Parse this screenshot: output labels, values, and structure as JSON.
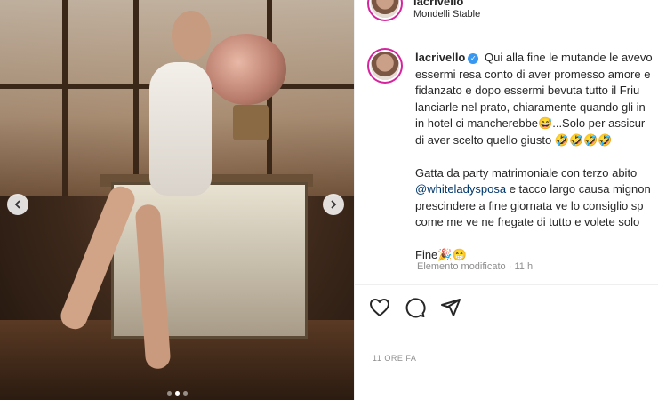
{
  "post": {
    "header": {
      "username": "lacrivello",
      "location": "Mondelli Stable"
    },
    "caption": {
      "username": "lacrivello",
      "paragraph1": "Qui alla fine le mutande le avevo\nessermi resa conto di aver promesso amore e\nfidanzato e dopo essermi bevuta tutto il Friu\nlanciarle nel prato, chiaramente quando gli in\nin hotel ci mancherebbe😅...Solo per assicur\ndi aver scelto quello giusto 🤣🤣🤣🤣",
      "paragraph2_start": "Gatta da party matrimoniale con terzo abito",
      "mention": "@whiteladysposa",
      "paragraph2_rest": " e tacco largo causa mignon\nprescindere a fine giornata ve lo consiglio sp\ncome me ve ne fregate di tutto e volete solo",
      "paragraph3": "Fine🎉😁"
    },
    "meta": {
      "edited": "Elemento modificato",
      "separator": "·",
      "age": "11 h"
    },
    "timestamp": "11 ORE FA",
    "carousel": {
      "total_dots": 3,
      "active_index": 1
    }
  },
  "icons": {
    "prev": "chevron-left-icon",
    "next": "chevron-right-icon",
    "like": "heart-icon",
    "comment": "comment-icon",
    "share": "share-icon",
    "verified": "verified-badge-icon"
  }
}
